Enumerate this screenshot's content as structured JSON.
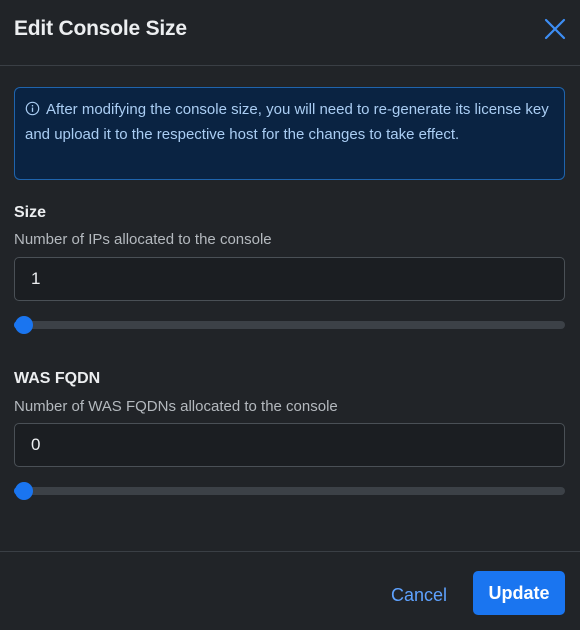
{
  "dialog": {
    "title": "Edit Console Size",
    "close_icon": "close-icon"
  },
  "info": {
    "icon": "info-circle-icon",
    "message": "After modifying the console size, you will need to re-generate its license key and upload it to the respective host for the changes to take effect."
  },
  "size": {
    "label": "Size",
    "help": "Number of IPs allocated to the console",
    "value": "1",
    "slider_level": 0
  },
  "was_fqdn": {
    "label": "WAS FQDN",
    "help": "Number of WAS FQDNs allocated to the console",
    "value": "0",
    "slider_level": 0
  },
  "footer": {
    "cancel_label": "Cancel",
    "update_label": "Update"
  },
  "colors": {
    "accent": "#1a75f0",
    "info_bg": "#0a2342",
    "info_border": "#1f64ad",
    "background": "#212428"
  }
}
